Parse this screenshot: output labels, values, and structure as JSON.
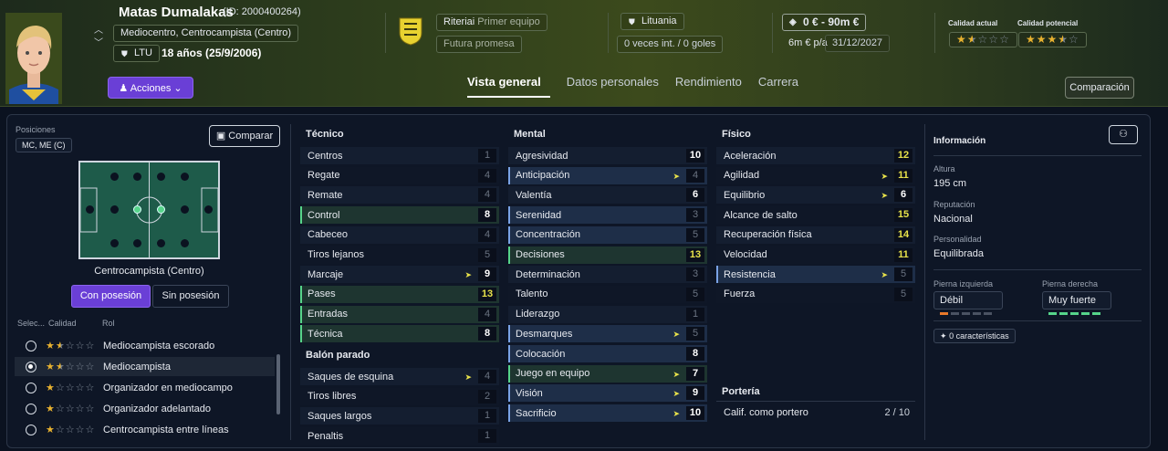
{
  "header": {
    "name": "Matas Dumalakas",
    "id": "(ID: 2000400264)",
    "position": "Mediocentro, Centrocampista (Centro)",
    "nationality_code": "LTU",
    "age": "18 años (25/9/2006)",
    "actions_label": "Acciones",
    "club": "Riteriai",
    "club_squad": "Primer equipo",
    "club_tag": "Futura promesa",
    "nation": "Lituania",
    "caps": "0 veces int. / 0 goles",
    "value": "0 € - 90m €",
    "wage": "6m € p/a",
    "contract_end": "31/12/2027",
    "current_quality_label": "Calidad actual",
    "potential_quality_label": "Calidad potencial",
    "current_stars": 1.5,
    "potential_stars": 3.5,
    "compare_label": "Comparación"
  },
  "tabs": [
    "Vista general",
    "Datos personales",
    "Rendimiento",
    "Carrera"
  ],
  "left": {
    "positions_label": "Posiciones",
    "positions_value": "MC, ME (C)",
    "compare_label": "Comparar",
    "role_title": "Centrocampista (Centro)",
    "with_ball": "Con posesión",
    "without_ball": "Sin posesión",
    "col_sel": "Selec...",
    "col_quality": "Calidad",
    "col_role": "Rol",
    "roles": [
      {
        "name": "Mediocampista escorado",
        "stars": 1.5,
        "selected": false
      },
      {
        "name": "Mediocampista",
        "stars": 1.5,
        "selected": true
      },
      {
        "name": "Organizador en mediocampo",
        "stars": 1,
        "selected": false
      },
      {
        "name": "Organizador adelantado",
        "stars": 1,
        "selected": false
      },
      {
        "name": "Centrocampista entre líneas",
        "stars": 1,
        "selected": false
      }
    ]
  },
  "technical": {
    "title": "Técnico",
    "attrs": [
      {
        "name": "Centros",
        "value": "1",
        "style": "alt",
        "grey": true
      },
      {
        "name": "Regate",
        "value": "4",
        "style": "",
        "grey": true
      },
      {
        "name": "Remate",
        "value": "4",
        "style": "alt",
        "grey": true
      },
      {
        "name": "Control",
        "value": "8",
        "style": "g"
      },
      {
        "name": "Cabeceo",
        "value": "4",
        "style": "alt",
        "grey": true
      },
      {
        "name": "Tiros lejanos",
        "value": "5",
        "style": "",
        "grey": true
      },
      {
        "name": "Marcaje",
        "value": "9",
        "style": "alt",
        "arrow": true
      },
      {
        "name": "Pases",
        "value": "13",
        "style": "g",
        "yellow": true
      },
      {
        "name": "Entradas",
        "value": "4",
        "style": "g",
        "grey": true
      },
      {
        "name": "Técnica",
        "value": "8",
        "style": "g"
      }
    ]
  },
  "set_pieces": {
    "title": "Balón parado",
    "attrs": [
      {
        "name": "Saques de esquina",
        "value": "4",
        "style": "alt",
        "grey": true,
        "arrow": true
      },
      {
        "name": "Tiros libres",
        "value": "2",
        "style": "",
        "grey": true
      },
      {
        "name": "Saques largos",
        "value": "1",
        "style": "alt",
        "grey": true
      },
      {
        "name": "Penaltis",
        "value": "1",
        "style": "",
        "grey": true
      }
    ]
  },
  "mental": {
    "title": "Mental",
    "attrs": [
      {
        "name": "Agresividad",
        "value": "10",
        "style": "alt"
      },
      {
        "name": "Anticipación",
        "value": "4",
        "style": "b",
        "grey": true,
        "arrow": true
      },
      {
        "name": "Valentía",
        "value": "6",
        "style": "alt"
      },
      {
        "name": "Serenidad",
        "value": "3",
        "style": "b",
        "grey": true
      },
      {
        "name": "Concentración",
        "value": "5",
        "style": "b",
        "grey": true
      },
      {
        "name": "Decisiones",
        "value": "13",
        "style": "g",
        "yellow": true
      },
      {
        "name": "Determinación",
        "value": "3",
        "style": "alt",
        "grey": true
      },
      {
        "name": "Talento",
        "value": "5",
        "style": "",
        "grey": true
      },
      {
        "name": "Liderazgo",
        "value": "1",
        "style": "alt",
        "grey": true
      },
      {
        "name": "Desmarques",
        "value": "5",
        "style": "b",
        "grey": true,
        "arrow": true
      },
      {
        "name": "Colocación",
        "value": "8",
        "style": "b"
      },
      {
        "name": "Juego en equipo",
        "value": "7",
        "style": "g",
        "arrow": true
      },
      {
        "name": "Visión",
        "value": "9",
        "style": "b",
        "arrow": true
      },
      {
        "name": "Sacrificio",
        "value": "10",
        "style": "b",
        "arrow": true
      }
    ]
  },
  "physical": {
    "title": "Físico",
    "attrs": [
      {
        "name": "Aceleración",
        "value": "12",
        "style": "alt",
        "yellow": true
      },
      {
        "name": "Agilidad",
        "value": "11",
        "style": "",
        "yellow": true,
        "arrow": true
      },
      {
        "name": "Equilibrio",
        "value": "6",
        "style": "alt",
        "arrow": true
      },
      {
        "name": "Alcance de salto",
        "value": "15",
        "style": "",
        "yellow": true
      },
      {
        "name": "Recuperación física",
        "value": "14",
        "style": "alt",
        "yellow": true
      },
      {
        "name": "Velocidad",
        "value": "11",
        "style": "",
        "yellow": true
      },
      {
        "name": "Resistencia",
        "value": "5",
        "style": "b",
        "grey": true,
        "arrow": true
      },
      {
        "name": "Fuerza",
        "value": "5",
        "style": "",
        "grey": true
      }
    ]
  },
  "goalkeeping": {
    "title": "Portería",
    "rating_label": "Calif. como portero",
    "rating_value": "2 / 10"
  },
  "info": {
    "title": "Información",
    "height_label": "Altura",
    "height": "195 cm",
    "reputation_label": "Reputación",
    "reputation": "Nacional",
    "personality_label": "Personalidad",
    "personality": "Equilibrada",
    "left_foot_label": "Pierna izquierda",
    "left_foot": "Débil",
    "left_foot_level": 1,
    "right_foot_label": "Pierna derecha",
    "right_foot": "Muy fuerte",
    "right_foot_level": 5,
    "traits": "0 características"
  },
  "colors": {
    "accent": "#6a3fd6",
    "green": "#56d48a",
    "yellow": "#e8e24a",
    "star": "#e8b230"
  }
}
